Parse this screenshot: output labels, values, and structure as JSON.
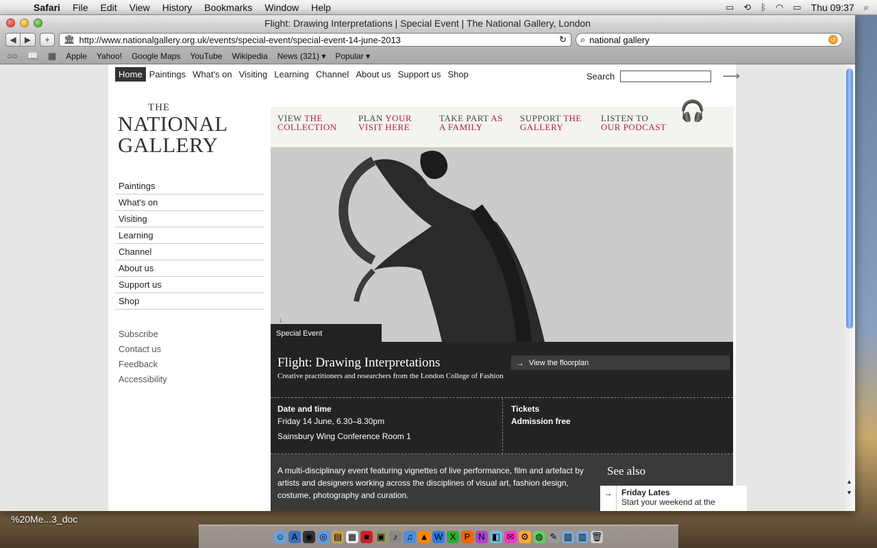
{
  "menubar": {
    "app": "Safari",
    "items": [
      "File",
      "Edit",
      "View",
      "History",
      "Bookmarks",
      "Window",
      "Help"
    ],
    "clock": "Thu 09:37"
  },
  "window": {
    "title": "Flight: Drawing Interpretations | Special Event | The National Gallery, London",
    "url": "http://www.nationalgallery.org.uk/events/special-event/special-event-14-june-2013",
    "search_query": "national gallery"
  },
  "bookmarks": [
    "Apple",
    "Yahoo!",
    "Google Maps",
    "YouTube",
    "Wikipedia",
    "News (321) ▾",
    "Popular ▾"
  ],
  "site": {
    "topnav": [
      "Home",
      "Paintings",
      "What's on",
      "Visiting",
      "Learning",
      "Channel",
      "About us",
      "Support us",
      "Shop"
    ],
    "search_label": "Search",
    "logo": {
      "the": "THE",
      "line1": "NATIONAL",
      "line2": "GALLERY"
    },
    "leftnav": [
      "Paintings",
      "What's on",
      "Visiting",
      "Learning",
      "Channel",
      "About us",
      "Support us",
      "Shop"
    ],
    "leftnav2": [
      "Subscribe",
      "Contact us",
      "Feedback",
      "Accessibility"
    ],
    "promo": [
      {
        "a": "View ",
        "b": "the collection"
      },
      {
        "a": "Plan ",
        "b": "your visit here"
      },
      {
        "a": "Take part ",
        "b": "as a family"
      },
      {
        "a": "Support ",
        "b": "the gallery"
      },
      {
        "a": "Listen to ",
        "b": "our podcast"
      }
    ],
    "hero_label": "Special Event",
    "event": {
      "title": "Flight: Drawing Interpretations",
      "subtitle": "Creative practitioners and researchers from the London College of Fashion",
      "floorplan": "View the floorplan",
      "datetime_heading": "Date and time",
      "datetime": "Friday 14 June, 6.30–8.30pm",
      "location": "Sainsbury Wing Conference Room 1",
      "tickets_heading": "Tickets",
      "tickets": "Admission free"
    },
    "description": "A multi-disciplinary event featuring vignettes of live performance, film and artefact by artists and designers working across the disciplines of visual art, fashion design, costume, photography and curation.",
    "see_also": {
      "heading": "See also",
      "card_title": "Friday Lates",
      "card_text": "Start your weekend at the"
    }
  },
  "desktop": {
    "label": "%20Me...3_doc"
  }
}
